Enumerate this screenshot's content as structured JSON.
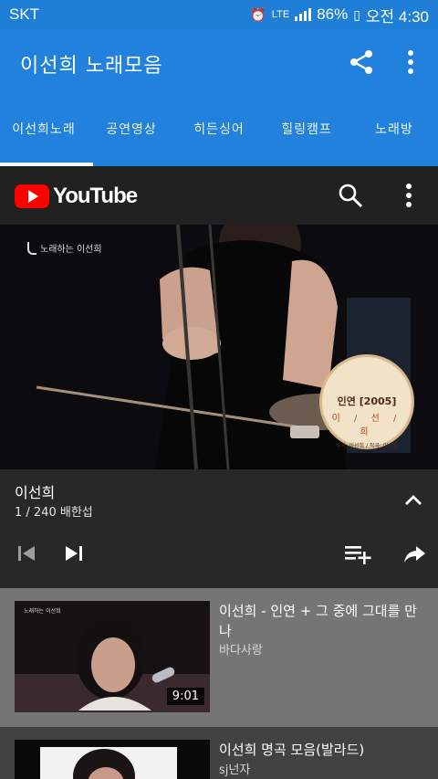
{
  "status_bar": {
    "carrier": "SKT",
    "network": "LTE",
    "battery": "86%",
    "time": "오전 4:30",
    "icons": [
      "alarm-icon",
      "lte-icon",
      "signal-icon",
      "battery-icon"
    ]
  },
  "app_bar": {
    "title": "이선희 노래모음",
    "actions": [
      "share-icon",
      "more-vert-icon"
    ],
    "color": "#2181dc"
  },
  "tabs": {
    "items": [
      "이선희노래",
      "공연영상",
      "히든싱어",
      "힐링캠프",
      "노래방"
    ],
    "selected": "이선희노래"
  },
  "player": {
    "brand": "YouTube",
    "header_actions": [
      "search-icon",
      "more-vert-icon"
    ],
    "video_watermark": "노래하는 이선희",
    "overlay_song": "인연 [2005]",
    "overlay_artist": "이 / 선 / 희",
    "overlay_credit": "작사: 이선희 / 작곡: 이선희",
    "title": "이선희",
    "meta": "1 / 240   배한섭",
    "controls": [
      "skip-previous-icon",
      "skip-next-icon",
      "add-to-queue-icon",
      "share-icon"
    ]
  },
  "list": {
    "items": [
      {
        "title": "이선희 - 인연 + 그 중에 그대를 만나",
        "channel": "바다사랑",
        "duration": "9:01",
        "thumb_label": "노래하는 이선희"
      },
      {
        "title": "이선희 명곡 모음(발라드)",
        "channel": "sj넌자"
      }
    ]
  }
}
